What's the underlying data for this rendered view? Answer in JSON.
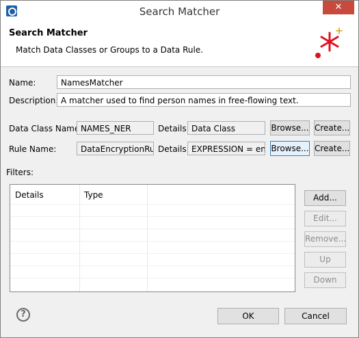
{
  "window": {
    "title": "Search Matcher",
    "close_glyph": "✕"
  },
  "header": {
    "title": "Search Matcher",
    "subtitle": "Match Data Classes or Groups to a Data Rule."
  },
  "form": {
    "name_label": "Name:",
    "name_value": "NamesMatcher",
    "description_label": "Description:",
    "description_value": "A matcher used to find person names in free-flowing text.",
    "data_class_label": "Data Class Name:",
    "data_class_value": "NAMES_NER",
    "data_class_details_label": "Details:",
    "data_class_details_value": "Data Class",
    "rule_label": "Rule Name:",
    "rule_value": "DataEncryptionRule",
    "rule_details_label": "Details:",
    "rule_details_value": "EXPRESSION = enc_t",
    "browse_label": "Browse...",
    "create_label": "Create..."
  },
  "filters": {
    "label": "Filters:",
    "columns": [
      "Details",
      "Type"
    ],
    "add_label": "Add...",
    "edit_label": "Edit...",
    "remove_label": "Remove...",
    "up_label": "Up",
    "down_label": "Down"
  },
  "footer": {
    "help_glyph": "?",
    "ok_label": "OK",
    "cancel_label": "Cancel"
  },
  "colors": {
    "close_button": "#c74a3c",
    "logo_red": "#e0101e",
    "logo_gold": "#d8a21a",
    "focus_border": "#3c7fb1"
  }
}
